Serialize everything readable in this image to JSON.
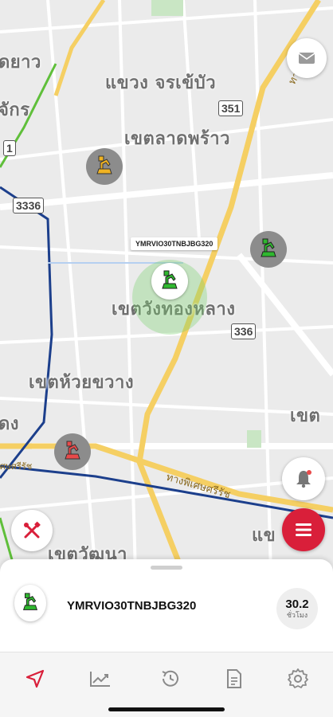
{
  "map": {
    "area_labels": [
      {
        "text": "ดยาว"
      },
      {
        "text": "แขวง จรเข้บัว"
      },
      {
        "text": "จักร"
      },
      {
        "text": "เขตลาดพร้าว"
      },
      {
        "text": "เขตวังทองหลาง"
      },
      {
        "text": "เขตห้วยขวาง"
      },
      {
        "text": "ดง"
      },
      {
        "text": "เขต"
      },
      {
        "text": "แข"
      },
      {
        "text": "เขตวัฒนา"
      }
    ],
    "road_shields": [
      "351",
      "1",
      "3336",
      "336"
    ],
    "road_names": [
      "ทางพิเศษ",
      "เศษศรีรัช",
      "ทางพิเศษศรีรัช"
    ],
    "selected_plate": "YMRVIO30TNBJBG320",
    "markers": [
      {
        "name": "excavator-marker-yellow",
        "color": "#f0b322"
      },
      {
        "name": "excavator-marker-green-east",
        "color": "#2fb82f"
      },
      {
        "name": "excavator-marker-green-selected",
        "color": "#2fb82f"
      },
      {
        "name": "excavator-marker-red",
        "color": "#e84a4a"
      }
    ]
  },
  "buttons": {
    "mail_icon": "mail-icon",
    "notification_icon": "bell-icon",
    "tools_icon": "tools-icon",
    "menu_icon": "menu-icon"
  },
  "vehicle": {
    "name": "YMRVIO30TNBJBG320",
    "speed": "30.2",
    "speed_unit": "ชั่วโมง",
    "status_color": "#2fb82f"
  },
  "tabs": [
    {
      "icon": "navigation-icon",
      "active": true
    },
    {
      "icon": "chart-icon",
      "active": false
    },
    {
      "icon": "history-icon",
      "active": false
    },
    {
      "icon": "document-icon",
      "active": false
    },
    {
      "icon": "settings-icon",
      "active": false
    }
  ],
  "colors": {
    "accent": "#d91f3a",
    "highway": "#f5cf63",
    "metro_blue": "#1c3f8c",
    "metro_green": "#5fbf3a"
  }
}
